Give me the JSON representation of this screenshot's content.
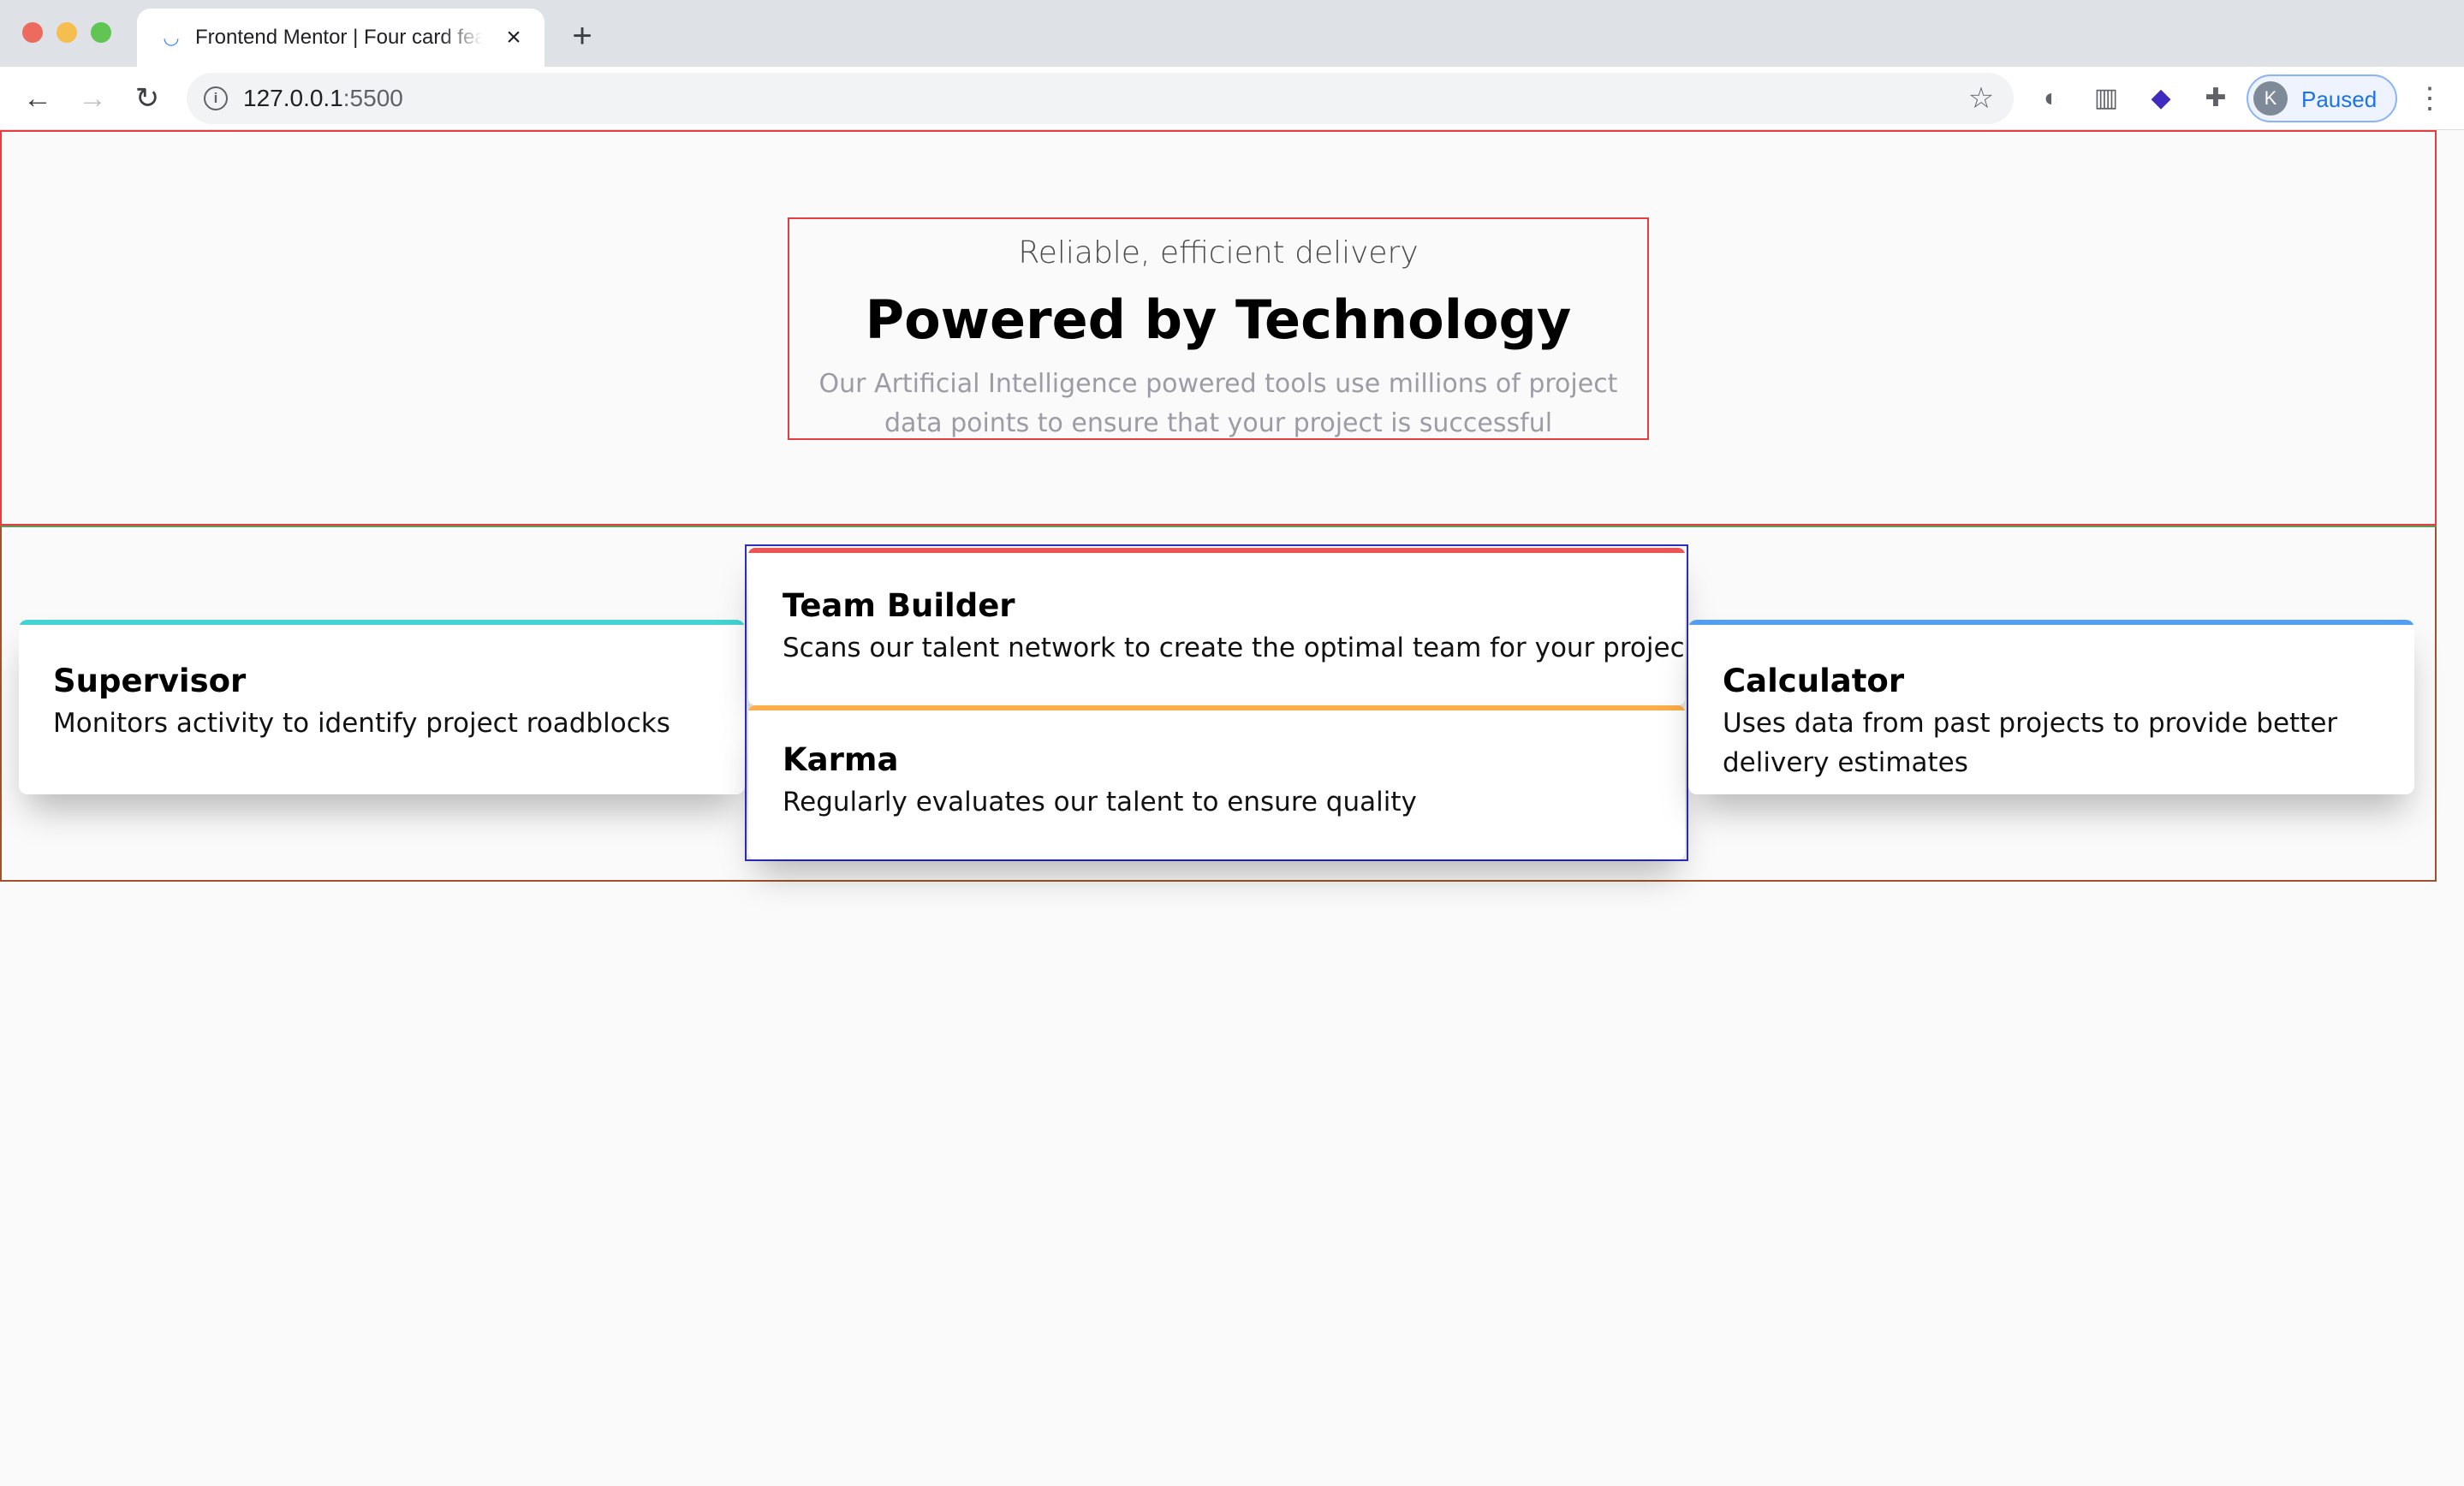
{
  "browser": {
    "tab_title": "Frontend Mentor | Four card feature section",
    "url_host": "127.0.0.1",
    "url_port": ":5500",
    "profile_initial": "K",
    "profile_status": "Paused",
    "icons": {
      "favicon": "frontend-mentor-icon",
      "close": "close-icon",
      "new_tab": "plus-icon",
      "back": "arrow-left-icon",
      "forward": "arrow-right-icon",
      "reload": "reload-icon",
      "info": "info-icon",
      "bookmark": "star-icon",
      "menu": "kebab-menu-icon"
    }
  },
  "header": {
    "tagline": "Reliable, efficient delivery",
    "headline": "Powered by Technology",
    "intro": "Our Artificial Intelligence powered tools use millions of project data points to ensure that your project is successful"
  },
  "cards": {
    "supervisor": {
      "title": "Supervisor",
      "description": "Monitors activity to identify project roadblocks",
      "accent": "#44d3d2"
    },
    "team_builder": {
      "title": "Team Builder",
      "description": "Scans our talent network to create the optimal team for your project",
      "accent": "#ea5454"
    },
    "karma": {
      "title": "Karma",
      "description": "Regularly evaluates our talent to ensure quality",
      "accent": "#fcae4a"
    },
    "calculator": {
      "title": "Calculator",
      "description": "Uses data from past projects to provide better delivery estimates",
      "accent": "#549ef2"
    }
  },
  "debug_outline_colors": {
    "header": "#e63e3e",
    "cards_section": "#a0522d",
    "center_column": "#2d2ec4"
  }
}
